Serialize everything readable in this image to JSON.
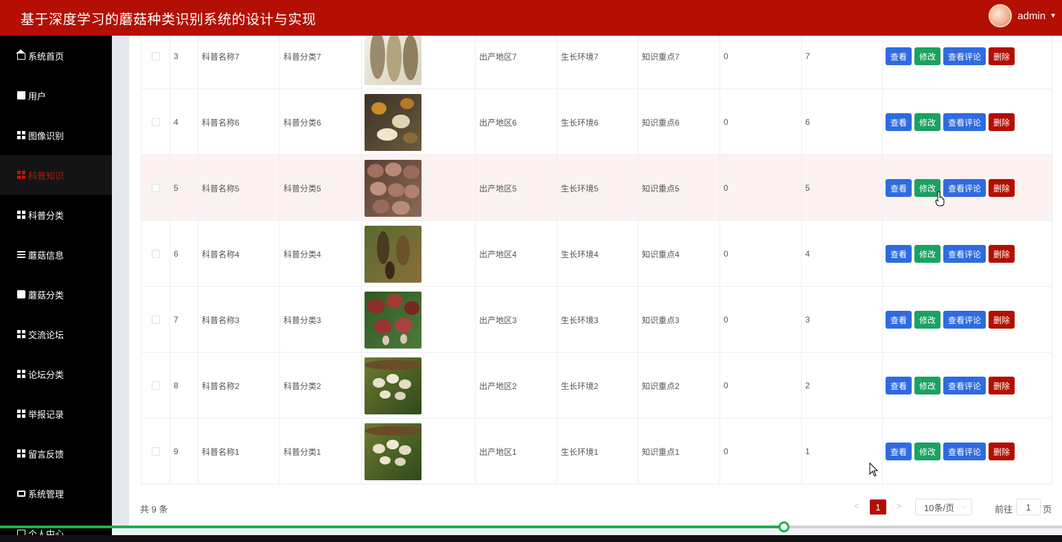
{
  "header": {
    "title": "基于深度学习的蘑菇种类识别系统的设计与实现",
    "username": "admin"
  },
  "sidebar": {
    "items": [
      {
        "label": "系统首页",
        "icon": "home-icon"
      },
      {
        "label": "用户",
        "icon": "clipboard-icon"
      },
      {
        "label": "图像识别",
        "icon": "grid-icon"
      },
      {
        "label": "科普知识",
        "icon": "grid-icon",
        "active": true
      },
      {
        "label": "科普分类",
        "icon": "grid-icon"
      },
      {
        "label": "蘑菇信息",
        "icon": "list-icon"
      },
      {
        "label": "蘑菇分类",
        "icon": "book-icon"
      },
      {
        "label": "交流论坛",
        "icon": "grid-icon"
      },
      {
        "label": "论坛分类",
        "icon": "grid-icon"
      },
      {
        "label": "举报记录",
        "icon": "grid-icon"
      },
      {
        "label": "留言反馈",
        "icon": "grid-icon"
      },
      {
        "label": "系统管理",
        "icon": "monitor-icon"
      },
      {
        "label": "个人中心",
        "icon": "card-icon"
      }
    ]
  },
  "table": {
    "actions": {
      "view": "查看",
      "edit": "修改",
      "comments": "查看评论",
      "delete": "删除"
    },
    "rows": [
      {
        "index": "3",
        "name": "科普名称7",
        "category": "科普分类7",
        "area": "出产地区7",
        "env": "生长环境7",
        "key": "知识重点7",
        "n1": "0",
        "n2": "7",
        "img": "a"
      },
      {
        "index": "4",
        "name": "科普名称6",
        "category": "科普分类6",
        "area": "出产地区6",
        "env": "生长环境6",
        "key": "知识重点6",
        "n1": "0",
        "n2": "6",
        "img": "b"
      },
      {
        "index": "5",
        "name": "科普名称5",
        "category": "科普分类5",
        "area": "出产地区5",
        "env": "生长环境5",
        "key": "知识重点5",
        "n1": "0",
        "n2": "5",
        "img": "c",
        "hover": true
      },
      {
        "index": "6",
        "name": "科普名称4",
        "category": "科普分类4",
        "area": "出产地区4",
        "env": "生长环境4",
        "key": "知识重点4",
        "n1": "0",
        "n2": "4",
        "img": "d"
      },
      {
        "index": "7",
        "name": "科普名称3",
        "category": "科普分类3",
        "area": "出产地区3",
        "env": "生长环境3",
        "key": "知识重点3",
        "n1": "0",
        "n2": "3",
        "img": "e"
      },
      {
        "index": "8",
        "name": "科普名称2",
        "category": "科普分类2",
        "area": "出产地区2",
        "env": "生长环境2",
        "key": "知识重点2",
        "n1": "0",
        "n2": "2",
        "img": "f"
      },
      {
        "index": "9",
        "name": "科普名称1",
        "category": "科普分类1",
        "area": "出产地区1",
        "env": "生长环境1",
        "key": "知识重点1",
        "n1": "0",
        "n2": "1",
        "img": "f"
      }
    ]
  },
  "pagination": {
    "total": "共 9 条",
    "prev": "<",
    "next": ">",
    "current": "1",
    "page_size": "10条/页",
    "goto_label": "前往",
    "goto_value": "1",
    "goto_unit": "页"
  },
  "video": {
    "progress": 0.738
  },
  "colors": {
    "primary": "#b30f02",
    "blue": "#2f6be0",
    "green": "#1aa260"
  }
}
